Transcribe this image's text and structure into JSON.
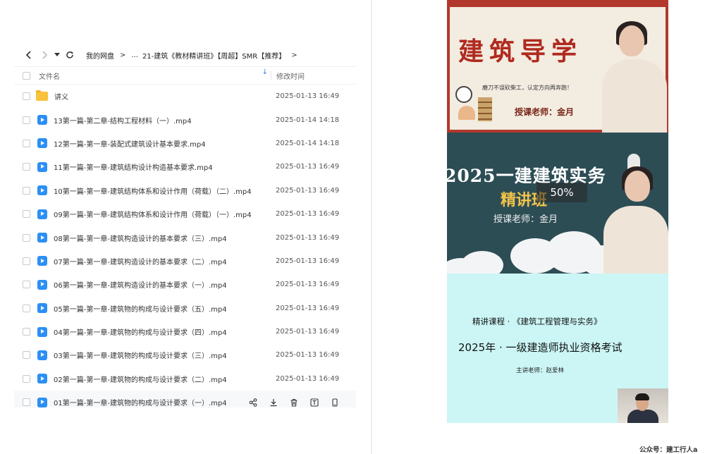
{
  "breadcrumb": {
    "root": "我的网盘",
    "ellipsis": "...",
    "current": "21-建筑《教材精讲班》【周超】SMR【推荐】"
  },
  "table": {
    "col_name": "文件名",
    "col_time": "修改时间"
  },
  "files": [
    {
      "type": "folder",
      "name": "讲义",
      "time": "2025-01-13 16:49"
    },
    {
      "type": "video",
      "name": "13第一篇-第二章-结构工程材料（一）.mp4",
      "time": "2025-01-14 14:18"
    },
    {
      "type": "video",
      "name": "12第一篇-第一章-装配式建筑设计基本要求.mp4",
      "time": "2025-01-14 14:18"
    },
    {
      "type": "video",
      "name": "11第一篇-第一章-建筑结构设计构造基本要求.mp4",
      "time": "2025-01-13 16:49"
    },
    {
      "type": "video",
      "name": "10第一篇-第一章-建筑结构体系和设计作用（荷载）（二）.mp4",
      "time": "2025-01-13 16:49"
    },
    {
      "type": "video",
      "name": "09第一篇-第一章-建筑结构体系和设计作用（荷载）（一）.mp4",
      "time": "2025-01-13 16:49"
    },
    {
      "type": "video",
      "name": "08第一篇-第一章-建筑构造设计的基本要求（三）.mp4",
      "time": "2025-01-13 16:49"
    },
    {
      "type": "video",
      "name": "07第一篇-第一章-建筑构造设计的基本要求（二）.mp4",
      "time": "2025-01-13 16:49"
    },
    {
      "type": "video",
      "name": "06第一篇-第一章-建筑构造设计的基本要求（一）.mp4",
      "time": "2025-01-13 16:49"
    },
    {
      "type": "video",
      "name": "05第一篇-第一章-建筑物的构成与设计要求（五）.mp4",
      "time": "2025-01-13 16:49"
    },
    {
      "type": "video",
      "name": "04第一篇-第一章-建筑物的构成与设计要求（四）.mp4",
      "time": "2025-01-13 16:49"
    },
    {
      "type": "video",
      "name": "03第一篇-第一章-建筑物的构成与设计要求（三）.mp4",
      "time": "2025-01-13 16:49"
    },
    {
      "type": "video",
      "name": "02第一篇-第一章-建筑物的构成与设计要求（二）.mp4",
      "time": "2025-01-13 16:49"
    },
    {
      "type": "video",
      "name": "01第一篇-第一章-建筑物的构成与设计要求（一）.mp4",
      "time": ""
    }
  ],
  "icons": {
    "row_actions": [
      "share-icon",
      "download-icon",
      "delete-icon",
      "text-icon",
      "phone-icon"
    ]
  },
  "poster": {
    "panel1": {
      "title": "建筑导学",
      "motto": "磨刀不误砍柴工，认定方向再奔跑！",
      "teacher": "授课老师：金月"
    },
    "panel2": {
      "title": "2025一建建筑实务",
      "subtitle": "精讲班",
      "teacher": "授课老师：金月",
      "progress_label": "50%"
    },
    "panel3": {
      "course": "精讲课程 · 《建筑工程管理与实务》",
      "exam": "2025年 · 一级建造师执业资格考试",
      "lecturer": "主讲老师：赵爱林"
    }
  },
  "watermark": "公众号：建工行人a",
  "colors": {
    "accent_blue": "#2c8ff5",
    "folder_yellow": "#f9c23c",
    "poster_red": "#b2382d",
    "poster_teal": "#2d4d55",
    "poster_cyan": "#ccf6f6"
  }
}
